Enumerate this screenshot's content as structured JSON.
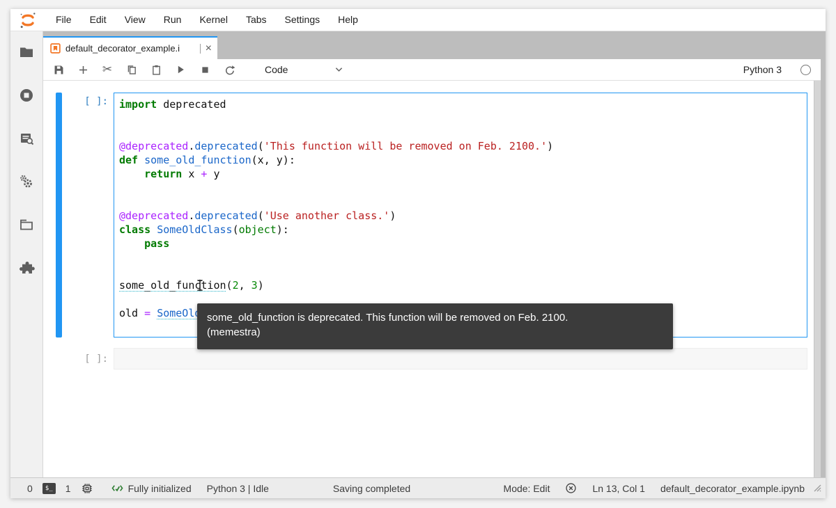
{
  "menu_bar": {
    "items": [
      "File",
      "Edit",
      "View",
      "Run",
      "Kernel",
      "Tabs",
      "Settings",
      "Help"
    ]
  },
  "tab": {
    "title": "default_decorator_example.i",
    "close_glyph": "×"
  },
  "toolbar": {
    "cell_type": "Code",
    "kernel_name": "Python 3"
  },
  "notebook": {
    "cells": [
      {
        "prompt": "[ ]:",
        "lines": [
          [
            {
              "t": "import",
              "c": "kw"
            },
            {
              "t": " deprecated",
              "c": "pl"
            }
          ],
          [],
          [],
          [
            {
              "t": "@deprecated",
              "c": "meta"
            },
            {
              "t": ".",
              "c": "pl"
            },
            {
              "t": "deprecated",
              "c": "def"
            },
            {
              "t": "(",
              "c": "pl"
            },
            {
              "t": "'This function will be removed on Feb. 2100.'",
              "c": "str"
            },
            {
              "t": ")",
              "c": "pl"
            }
          ],
          [
            {
              "t": "def",
              "c": "kw"
            },
            {
              "t": " ",
              "c": "pl"
            },
            {
              "t": "some_old_function",
              "c": "def"
            },
            {
              "t": "(x, y):",
              "c": "pl"
            }
          ],
          [
            {
              "t": "    ",
              "c": "pl"
            },
            {
              "t": "return",
              "c": "kw"
            },
            {
              "t": " x ",
              "c": "pl"
            },
            {
              "t": "+",
              "c": "op"
            },
            {
              "t": " y",
              "c": "pl"
            }
          ],
          [],
          [],
          [
            {
              "t": "@deprecated",
              "c": "meta"
            },
            {
              "t": ".",
              "c": "pl"
            },
            {
              "t": "deprecated",
              "c": "def"
            },
            {
              "t": "(",
              "c": "pl"
            },
            {
              "t": "'Use another class.'",
              "c": "str"
            },
            {
              "t": ")",
              "c": "pl"
            }
          ],
          [
            {
              "t": "class",
              "c": "kw"
            },
            {
              "t": " ",
              "c": "pl"
            },
            {
              "t": "SomeOldClass",
              "c": "def"
            },
            {
              "t": "(",
              "c": "pl"
            },
            {
              "t": "object",
              "c": "builtin"
            },
            {
              "t": "):",
              "c": "pl"
            }
          ],
          [
            {
              "t": "    ",
              "c": "pl"
            },
            {
              "t": "pass",
              "c": "kw"
            }
          ],
          [],
          [],
          [
            {
              "t": "some_old_function",
              "c": "pl lint"
            },
            {
              "t": "(",
              "c": "pl"
            },
            {
              "t": "2",
              "c": "num"
            },
            {
              "t": ", ",
              "c": "pl"
            },
            {
              "t": "3",
              "c": "num"
            },
            {
              "t": ")",
              "c": "pl"
            }
          ],
          [],
          [
            {
              "t": "old ",
              "c": "pl"
            },
            {
              "t": "=",
              "c": "op"
            },
            {
              "t": " ",
              "c": "pl"
            },
            {
              "t": "SomeOldClass",
              "c": "def lint"
            },
            {
              "t": "()",
              "c": "pl"
            }
          ],
          []
        ]
      },
      {
        "prompt": "[ ]:",
        "lines": []
      }
    ]
  },
  "tooltip": {
    "line1": "some_old_function is deprecated. This function will be removed on Feb. 2100.",
    "line2": "(memestra)"
  },
  "status_bar": {
    "terminals_count": "0",
    "terminal_icon_label": "$_",
    "kernels_count": "1",
    "lsp_status": "Fully initialized",
    "kernel_status": "Python 3 | Idle",
    "save_status": "Saving completed",
    "mode": "Mode: Edit",
    "cursor_position": "Ln 13, Col 1",
    "filename": "default_decorator_example.ipynb"
  },
  "colors": {
    "accent_blue": "#2196f3",
    "jupyter_orange": "#f37726",
    "tooltip_bg": "#3b3b3b",
    "dock_gray": "#bdbdbd"
  }
}
